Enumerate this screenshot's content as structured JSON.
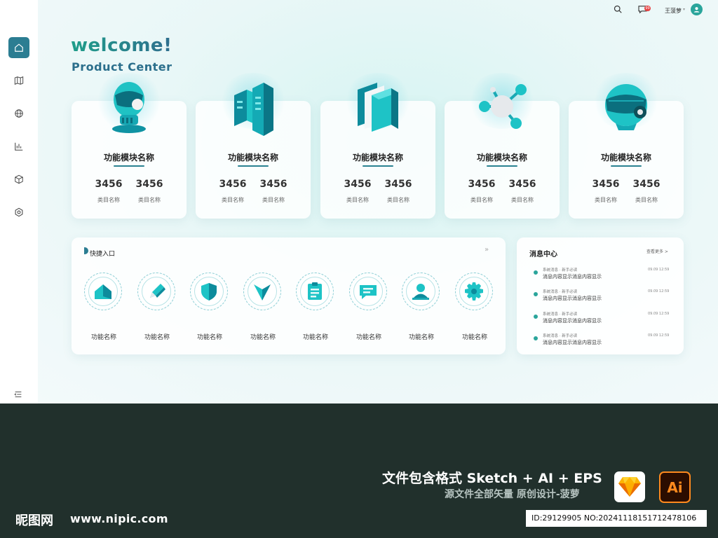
{
  "header": {
    "welcome": "welcome!",
    "subtitle": "Product Center",
    "notification_count": "99",
    "username": "王菠萝",
    "caret": "▾"
  },
  "modules": [
    {
      "title": "功能模块名称",
      "icon": "robot-head-icon",
      "stats": [
        {
          "value": "3456",
          "label": "类目名称"
        },
        {
          "value": "3456",
          "label": "类目名称"
        }
      ]
    },
    {
      "title": "功能模块名称",
      "icon": "buildings-icon",
      "stats": [
        {
          "value": "3456",
          "label": "类目名称"
        },
        {
          "value": "3456",
          "label": "类目名称"
        }
      ]
    },
    {
      "title": "功能模块名称",
      "icon": "file-stack-icon",
      "stats": [
        {
          "value": "3456",
          "label": "类目名称"
        },
        {
          "value": "3456",
          "label": "类目名称"
        }
      ]
    },
    {
      "title": "功能模块名称",
      "icon": "molecule-icon",
      "stats": [
        {
          "value": "3456",
          "label": "类目名称"
        },
        {
          "value": "3456",
          "label": "类目名称"
        }
      ]
    },
    {
      "title": "功能模块名称",
      "icon": "helmet-icon",
      "stats": [
        {
          "value": "3456",
          "label": "类目名称"
        },
        {
          "value": "3456",
          "label": "类目名称"
        }
      ]
    }
  ],
  "quick": {
    "title": "快捷入口",
    "more": "»",
    "items": [
      {
        "label": "功能名称",
        "icon": "home-icon"
      },
      {
        "label": "功能名称",
        "icon": "pencil-icon"
      },
      {
        "label": "功能名称",
        "icon": "shield-icon"
      },
      {
        "label": "功能名称",
        "icon": "navigation-arrow-icon"
      },
      {
        "label": "功能名称",
        "icon": "clipboard-icon"
      },
      {
        "label": "功能名称",
        "icon": "chat-bubble-icon"
      },
      {
        "label": "功能名称",
        "icon": "user-icon"
      },
      {
        "label": "功能名称",
        "icon": "gear-icon"
      }
    ]
  },
  "messages": {
    "title": "消息中心",
    "more": "查看更多 >",
    "items": [
      {
        "type": "系统消息 · 新手必读",
        "text": "消息内容显示消息内容显示",
        "time": "09.09 12:59"
      },
      {
        "type": "系统消息 · 新手必读",
        "text": "消息内容显示消息内容显示",
        "time": "09.09 12:59"
      },
      {
        "type": "系统消息 · 新手必读",
        "text": "消息内容显示消息内容显示",
        "time": "09.09 12:59"
      },
      {
        "type": "系统消息 · 新手必读",
        "text": "消息内容显示消息内容显示",
        "time": "09.09 12:59"
      }
    ]
  },
  "banner": {
    "main": "文件包含格式 Sketch + AI + EPS",
    "sub": "源文件全部矢量 原创设计-菠萝",
    "ai_label": "Ai",
    "watermark": "昵图网",
    "watermark_url": "www.nipic.com",
    "id_text": "ID:29129905 NO:20241118151712478106"
  },
  "colors": {
    "accent": "#2b7d92",
    "teal": "#2aa59b",
    "banner_bg": "#21302c"
  }
}
